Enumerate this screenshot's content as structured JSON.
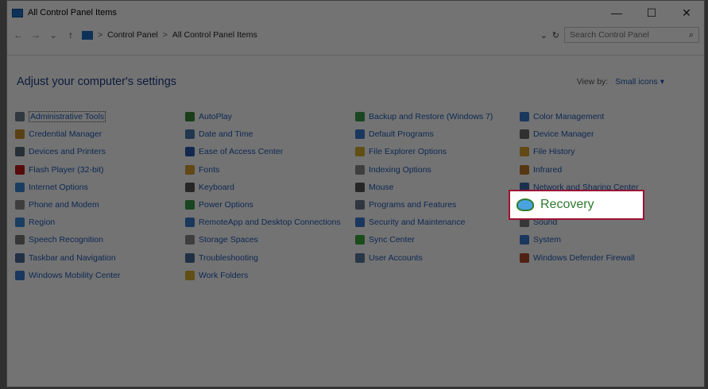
{
  "window": {
    "title": "All Control Panel Items",
    "minimize": "—",
    "maximize": "☐",
    "close": "✕"
  },
  "address": {
    "back": "←",
    "forward": "→",
    "recent": "⌄",
    "up": "↑",
    "crumbs": [
      "Control Panel",
      "All Control Panel Items"
    ],
    "separator": ">",
    "dropdown": "⌄",
    "refresh": "↻",
    "search_placeholder": "Search Control Panel"
  },
  "main": {
    "heading": "Adjust your computer's settings",
    "view_by_label": "View by:",
    "view_by_value": "Small icons ▾"
  },
  "columns": [
    [
      {
        "label": "Administrative Tools",
        "icon": "admin-tools-icon",
        "color": "#6d7f8f"
      },
      {
        "label": "Credential Manager",
        "icon": "credential-icon",
        "color": "#c8902a"
      },
      {
        "label": "Devices and Printers",
        "icon": "printer-icon",
        "color": "#5a6a7a"
      },
      {
        "label": "Flash Player (32-bit)",
        "icon": "flash-icon",
        "color": "#c01a1a"
      },
      {
        "label": "Internet Options",
        "icon": "internet-icon",
        "color": "#3a8ad8"
      },
      {
        "label": "Phone and Modem",
        "icon": "phone-icon",
        "color": "#8a8a8a"
      },
      {
        "label": "Region",
        "icon": "region-icon",
        "color": "#3a8ad8"
      },
      {
        "label": "Speech Recognition",
        "icon": "microphone-icon",
        "color": "#7a7a7a"
      },
      {
        "label": "Taskbar and Navigation",
        "icon": "taskbar-icon",
        "color": "#4a6a9a"
      },
      {
        "label": "Windows Mobility Center",
        "icon": "mobility-icon",
        "color": "#3a7ad0"
      }
    ],
    [
      {
        "label": "AutoPlay",
        "icon": "autoplay-icon",
        "color": "#3a8a3a"
      },
      {
        "label": "Date and Time",
        "icon": "clock-icon",
        "color": "#4a7ab0"
      },
      {
        "label": "Ease of Access Center",
        "icon": "ease-of-access-icon",
        "color": "#2a5ab0"
      },
      {
        "label": "Fonts",
        "icon": "fonts-icon",
        "color": "#d8a030"
      },
      {
        "label": "Keyboard",
        "icon": "keyboard-icon",
        "color": "#555"
      },
      {
        "label": "Power Options",
        "icon": "power-icon",
        "color": "#3a9a4a"
      },
      {
        "label": "RemoteApp and Desktop Connections",
        "icon": "remoteapp-icon",
        "color": "#3a7ad0"
      },
      {
        "label": "Storage Spaces",
        "icon": "storage-icon",
        "color": "#8a8a8a"
      },
      {
        "label": "Troubleshooting",
        "icon": "troubleshoot-icon",
        "color": "#4a6a9a"
      },
      {
        "label": "Work Folders",
        "icon": "folder-icon",
        "color": "#d8b030"
      }
    ],
    [
      {
        "label": "Backup and Restore (Windows 7)",
        "icon": "backup-icon",
        "color": "#3a9a4a"
      },
      {
        "label": "Default Programs",
        "icon": "default-programs-icon",
        "color": "#3a7ad0"
      },
      {
        "label": "File Explorer Options",
        "icon": "folder-options-icon",
        "color": "#d8b030"
      },
      {
        "label": "Indexing Options",
        "icon": "indexing-icon",
        "color": "#8a8a8a"
      },
      {
        "label": "Mouse",
        "icon": "mouse-icon",
        "color": "#555"
      },
      {
        "label": "Programs and Features",
        "icon": "programs-icon",
        "color": "#6a7a8a"
      },
      {
        "label": "Security and Maintenance",
        "icon": "flag-icon",
        "color": "#3a7ad0"
      },
      {
        "label": "Sync Center",
        "icon": "sync-icon",
        "color": "#3aa83a"
      },
      {
        "label": "User Accounts",
        "icon": "users-icon",
        "color": "#5a7aa0"
      }
    ],
    [
      {
        "label": "Color Management",
        "icon": "color-management-icon",
        "color": "#3a7ad0"
      },
      {
        "label": "Device Manager",
        "icon": "device-manager-icon",
        "color": "#6a6a6a"
      },
      {
        "label": "File History",
        "icon": "file-history-icon",
        "color": "#d8a030"
      },
      {
        "label": "Infrared",
        "icon": "infrared-icon",
        "color": "#c07a2a"
      },
      {
        "label": "Network and Sharing Center",
        "icon": "network-icon",
        "color": "#3a6ab0"
      },
      {
        "label": "Recovery",
        "icon": "recovery-icon",
        "color": "#3a9ad8"
      },
      {
        "label": "Sound",
        "icon": "speaker-icon",
        "color": "#7a7a7a"
      },
      {
        "label": "System",
        "icon": "system-icon",
        "color": "#3a7ad0"
      },
      {
        "label": "Windows Defender Firewall",
        "icon": "firewall-icon",
        "color": "#b04a2a"
      }
    ]
  ],
  "highlight": {
    "label": "Recovery",
    "border_color": "#9c1134",
    "text_color": "#2d7a2d"
  }
}
